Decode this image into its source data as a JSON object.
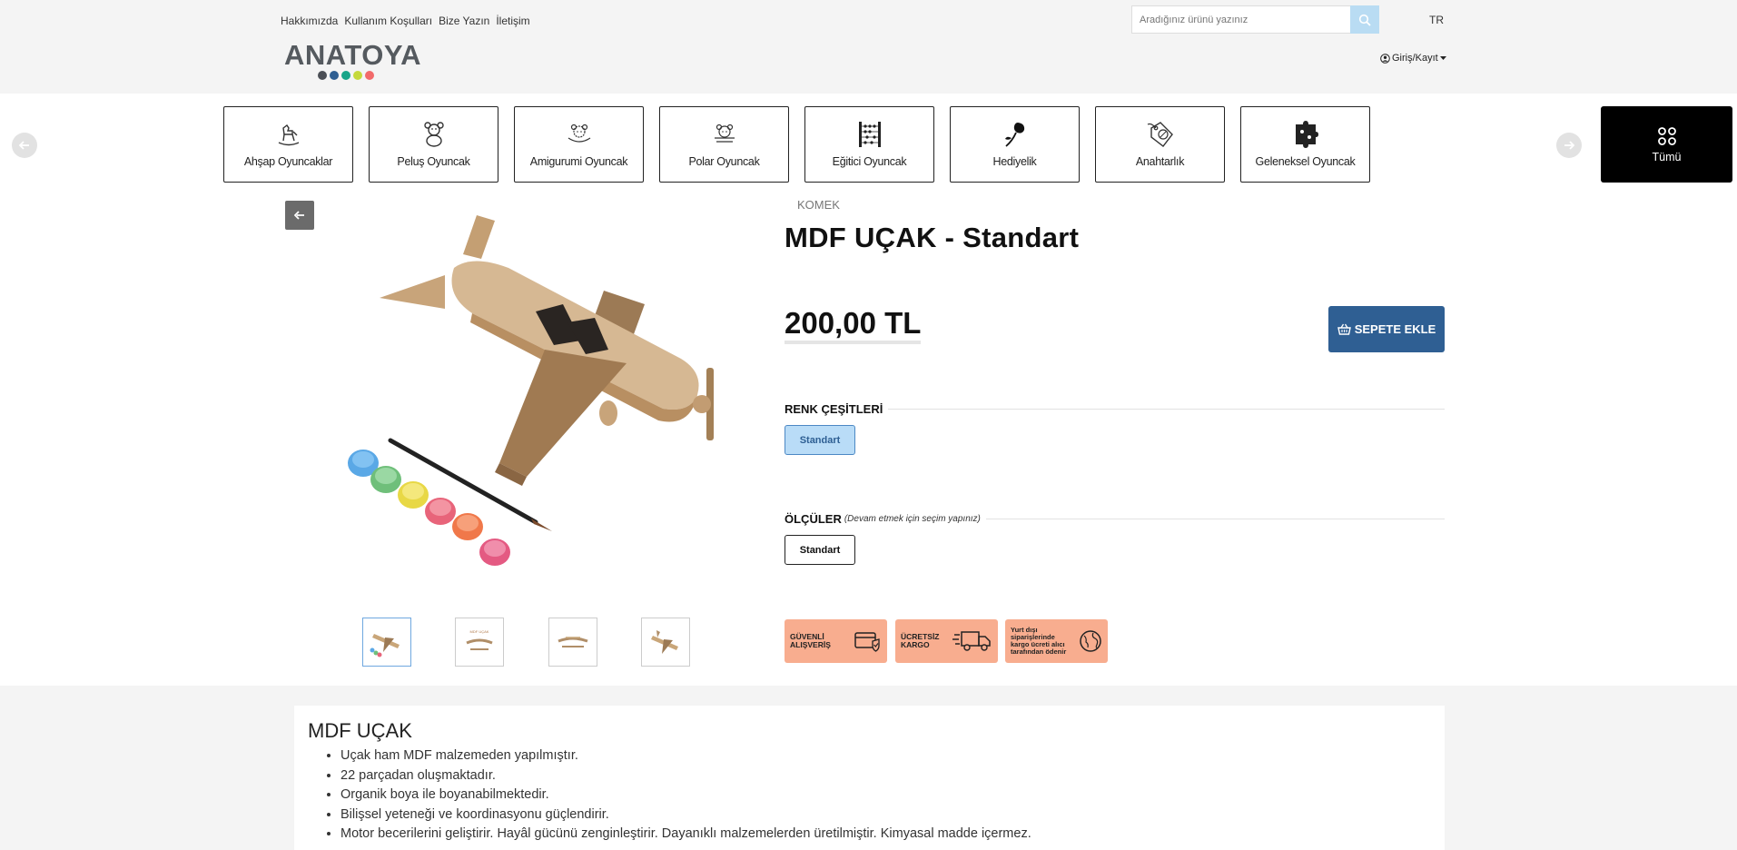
{
  "header": {
    "top_links": [
      "Hakkımızda",
      "Kullanım Koşulları",
      "Bize Yazın",
      "İletişim"
    ],
    "logo_text": "ANATOYA",
    "logo_dot_colors": [
      "#4b4f55",
      "#2f5f93",
      "#17a589",
      "#c5d93b",
      "#f26a6a"
    ],
    "search_placeholder": "Aradığınız ürünü yazınız",
    "language": "TR",
    "login_label": "Giriş/Kayıt"
  },
  "categories": [
    {
      "label": "Ahşap Oyuncaklar",
      "icon": "rocking-horse-icon"
    },
    {
      "label": "Peluş Oyuncak",
      "icon": "teddy-bear-icon"
    },
    {
      "label": "Amigurumi Oyuncak",
      "icon": "amigurumi-bear-icon"
    },
    {
      "label": "Polar Oyuncak",
      "icon": "polar-bear-icon"
    },
    {
      "label": "Eğitici Oyuncak",
      "icon": "abacus-icon"
    },
    {
      "label": "Hediyelik",
      "icon": "rose-icon"
    },
    {
      "label": "Anahtarlık",
      "icon": "tag-icon"
    },
    {
      "label": "Geleneksel Oyuncak",
      "icon": "puzzle-icon"
    }
  ],
  "all_categories_label": "Tümü",
  "product": {
    "brand": "KOMEK",
    "title": "MDF UÇAK - Standart",
    "price": "200,00 TL",
    "add_to_cart": "SEPETE EKLE",
    "color_section": "RENK ÇEŞİTLERİ",
    "color_option": "Standart",
    "size_section": "ÖLÇÜLER",
    "size_note": "(Devam etmek için seçim yapınız)",
    "size_option": "Standart",
    "thumbnail_count": 4
  },
  "badges": [
    {
      "text": "GÜVENLİ ALIŞVERİŞ",
      "icon": "secure-card-icon"
    },
    {
      "text": "ÜCRETSİZ KARGO",
      "icon": "truck-icon"
    },
    {
      "text": "Yurt dışı siparişlerinde kargo ücreti alıcı tarafından ödenir",
      "icon": "globe-icon"
    }
  ],
  "description": {
    "heading": "MDF UÇAK",
    "items": [
      "Uçak ham MDF malzemeden yapılmıştır.",
      "22 parçadan oluşmaktadır.",
      "Organik boya ile boyanabilmektedir.",
      "Bilişsel yeteneği ve koordinasyonu güçlendirir.",
      "Motor becerilerini geliştirir. Hayâl gücünü zenginleştirir. Dayanıklı malzemelerden üretilmiştir. Kimyasal madde içermez."
    ]
  }
}
